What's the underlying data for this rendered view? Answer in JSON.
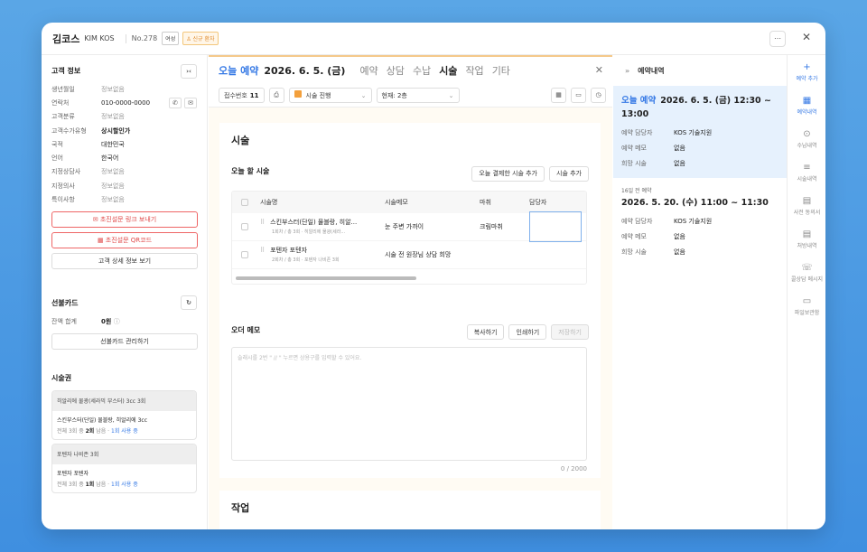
{
  "header": {
    "name": "김코스",
    "name_en": "KIM KOS",
    "number": "No.278",
    "gender": "여성",
    "new_badge": "신규 환자"
  },
  "left": {
    "section_title": "고객 정보",
    "fields": [
      {
        "key": "생년월일",
        "value": "정보없음",
        "muted": true
      },
      {
        "key": "연락처",
        "value": "010-0000-0000",
        "muted": false
      },
      {
        "key": "고객분류",
        "value": "정보없음",
        "muted": true
      },
      {
        "key": "고객수가유형",
        "value": "상시할인가",
        "muted": false,
        "bold": true
      },
      {
        "key": "국적",
        "value": "대한민국",
        "muted": false
      },
      {
        "key": "언어",
        "value": "한국어",
        "muted": false
      },
      {
        "key": "지정상담사",
        "value": "정보없음",
        "muted": true
      },
      {
        "key": "지정의사",
        "value": "정보없음",
        "muted": true
      },
      {
        "key": "특이사항",
        "value": "정보없음",
        "muted": true
      }
    ],
    "btn_link": "초진설문 링크 보내기",
    "btn_qr": "초진설문 QR코드",
    "btn_detail": "고객 상세 정보 보기",
    "prepaid_title": "선불카드",
    "balance_label": "잔액 합계",
    "balance_value": "0원",
    "btn_prepaid": "선불카드 관리하기",
    "voucher_title": "시술권",
    "vouchers": [
      {
        "head": "히알리에 물광(세라믹 부스터) 3cc 3회",
        "name": "스킨부스터(단일) 물블랑, 히알리에 3cc",
        "pre": "전체 3회 중 ",
        "count": "2회",
        "mid": " 남음 · ",
        "link": "1회 사용 중"
      },
      {
        "head": "포텐자 나비존 3회",
        "name": "포텐자 포텐자",
        "pre": "전체 3회 중 ",
        "count": "1회",
        "mid": " 남음 · ",
        "link": "1회 사용 중"
      }
    ]
  },
  "mid": {
    "today": "오늘 예약",
    "date": "2026. 6. 5. (금)",
    "tabs": [
      "예약",
      "상담",
      "수납",
      "시술",
      "작업",
      "기타"
    ],
    "active_tab": "시술",
    "reception_label": "접수번호",
    "reception_no": "11",
    "status": "시술 진행",
    "location": "현재: 2층",
    "section_title": "시술",
    "todo_label": "오늘 할 시술",
    "btn_add_paid": "오늘 결제한 시술 추가",
    "btn_add": "시술 추가",
    "columns": [
      "시술명",
      "시술메모",
      "마취",
      "담당자"
    ],
    "rows": [
      {
        "name": "스킨부스터(단일) 물블랑, 히알...",
        "sub": "1회차 / 총 3회 · 히알리에 물광(세라...",
        "memo": "눈 주변 가까이",
        "anes": "크림마취"
      },
      {
        "name": "포텐자 포텐자",
        "sub": "2회차 / 총 3회 · 포텐자 나비존 3회",
        "memo": "시술 전 원장님 상담 희망",
        "anes": ""
      }
    ],
    "order_memo": "오더 메모",
    "btn_copy": "복사하기",
    "btn_print": "인쇄하기",
    "btn_save": "저장하기",
    "memo_placeholder": "슬래시를 2번 \" // \" 누르면 상용구를 입력할 수 있어요.",
    "counter": "0 / 2000",
    "work_title": "작업"
  },
  "right": {
    "title": "예약내역",
    "cards": [
      {
        "today": "오늘 예약",
        "date": "2026. 6. 5. (금) 12:30 ~ 13:00",
        "rows": [
          [
            "예약 담당자",
            "KOS 기술지원"
          ],
          [
            "예약 메모",
            "없음"
          ],
          [
            "희망 시술",
            "없음"
          ]
        ]
      },
      {
        "ago": "16일 전 예약",
        "date": "2026. 5. 20. (수) 11:00 ~ 11:30",
        "rows": [
          [
            "예약 담당자",
            "KOS 기술지원"
          ],
          [
            "예약 메모",
            "없음"
          ],
          [
            "희망 시술",
            "없음"
          ]
        ]
      }
    ]
  },
  "sidebar": [
    {
      "label": "예약 추가",
      "icon": "+"
    },
    {
      "label": "예약내역",
      "icon": "▦"
    },
    {
      "label": "수납내역",
      "icon": "⊙"
    },
    {
      "label": "시술내역",
      "icon": "≡"
    },
    {
      "label": "사전 동의서",
      "icon": "▤"
    },
    {
      "label": "처방내역",
      "icon": "▤"
    },
    {
      "label": "콜상담 메시지",
      "icon": "☏"
    },
    {
      "label": "파일보관함",
      "icon": "▭"
    }
  ]
}
